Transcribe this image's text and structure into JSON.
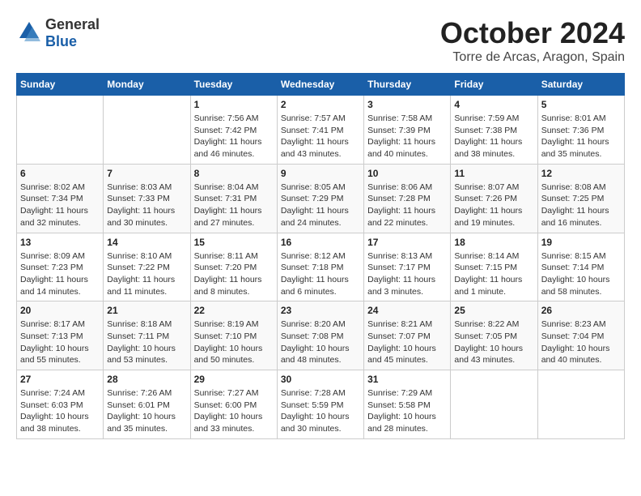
{
  "header": {
    "logo_general": "General",
    "logo_blue": "Blue",
    "month": "October 2024",
    "location": "Torre de Arcas, Aragon, Spain"
  },
  "weekdays": [
    "Sunday",
    "Monday",
    "Tuesday",
    "Wednesday",
    "Thursday",
    "Friday",
    "Saturday"
  ],
  "weeks": [
    [
      {
        "day": "",
        "info": ""
      },
      {
        "day": "",
        "info": ""
      },
      {
        "day": "1",
        "info": "Sunrise: 7:56 AM\nSunset: 7:42 PM\nDaylight: 11 hours and 46 minutes."
      },
      {
        "day": "2",
        "info": "Sunrise: 7:57 AM\nSunset: 7:41 PM\nDaylight: 11 hours and 43 minutes."
      },
      {
        "day": "3",
        "info": "Sunrise: 7:58 AM\nSunset: 7:39 PM\nDaylight: 11 hours and 40 minutes."
      },
      {
        "day": "4",
        "info": "Sunrise: 7:59 AM\nSunset: 7:38 PM\nDaylight: 11 hours and 38 minutes."
      },
      {
        "day": "5",
        "info": "Sunrise: 8:01 AM\nSunset: 7:36 PM\nDaylight: 11 hours and 35 minutes."
      }
    ],
    [
      {
        "day": "6",
        "info": "Sunrise: 8:02 AM\nSunset: 7:34 PM\nDaylight: 11 hours and 32 minutes."
      },
      {
        "day": "7",
        "info": "Sunrise: 8:03 AM\nSunset: 7:33 PM\nDaylight: 11 hours and 30 minutes."
      },
      {
        "day": "8",
        "info": "Sunrise: 8:04 AM\nSunset: 7:31 PM\nDaylight: 11 hours and 27 minutes."
      },
      {
        "day": "9",
        "info": "Sunrise: 8:05 AM\nSunset: 7:29 PM\nDaylight: 11 hours and 24 minutes."
      },
      {
        "day": "10",
        "info": "Sunrise: 8:06 AM\nSunset: 7:28 PM\nDaylight: 11 hours and 22 minutes."
      },
      {
        "day": "11",
        "info": "Sunrise: 8:07 AM\nSunset: 7:26 PM\nDaylight: 11 hours and 19 minutes."
      },
      {
        "day": "12",
        "info": "Sunrise: 8:08 AM\nSunset: 7:25 PM\nDaylight: 11 hours and 16 minutes."
      }
    ],
    [
      {
        "day": "13",
        "info": "Sunrise: 8:09 AM\nSunset: 7:23 PM\nDaylight: 11 hours and 14 minutes."
      },
      {
        "day": "14",
        "info": "Sunrise: 8:10 AM\nSunset: 7:22 PM\nDaylight: 11 hours and 11 minutes."
      },
      {
        "day": "15",
        "info": "Sunrise: 8:11 AM\nSunset: 7:20 PM\nDaylight: 11 hours and 8 minutes."
      },
      {
        "day": "16",
        "info": "Sunrise: 8:12 AM\nSunset: 7:18 PM\nDaylight: 11 hours and 6 minutes."
      },
      {
        "day": "17",
        "info": "Sunrise: 8:13 AM\nSunset: 7:17 PM\nDaylight: 11 hours and 3 minutes."
      },
      {
        "day": "18",
        "info": "Sunrise: 8:14 AM\nSunset: 7:15 PM\nDaylight: 11 hours and 1 minute."
      },
      {
        "day": "19",
        "info": "Sunrise: 8:15 AM\nSunset: 7:14 PM\nDaylight: 10 hours and 58 minutes."
      }
    ],
    [
      {
        "day": "20",
        "info": "Sunrise: 8:17 AM\nSunset: 7:13 PM\nDaylight: 10 hours and 55 minutes."
      },
      {
        "day": "21",
        "info": "Sunrise: 8:18 AM\nSunset: 7:11 PM\nDaylight: 10 hours and 53 minutes."
      },
      {
        "day": "22",
        "info": "Sunrise: 8:19 AM\nSunset: 7:10 PM\nDaylight: 10 hours and 50 minutes."
      },
      {
        "day": "23",
        "info": "Sunrise: 8:20 AM\nSunset: 7:08 PM\nDaylight: 10 hours and 48 minutes."
      },
      {
        "day": "24",
        "info": "Sunrise: 8:21 AM\nSunset: 7:07 PM\nDaylight: 10 hours and 45 minutes."
      },
      {
        "day": "25",
        "info": "Sunrise: 8:22 AM\nSunset: 7:05 PM\nDaylight: 10 hours and 43 minutes."
      },
      {
        "day": "26",
        "info": "Sunrise: 8:23 AM\nSunset: 7:04 PM\nDaylight: 10 hours and 40 minutes."
      }
    ],
    [
      {
        "day": "27",
        "info": "Sunrise: 7:24 AM\nSunset: 6:03 PM\nDaylight: 10 hours and 38 minutes."
      },
      {
        "day": "28",
        "info": "Sunrise: 7:26 AM\nSunset: 6:01 PM\nDaylight: 10 hours and 35 minutes."
      },
      {
        "day": "29",
        "info": "Sunrise: 7:27 AM\nSunset: 6:00 PM\nDaylight: 10 hours and 33 minutes."
      },
      {
        "day": "30",
        "info": "Sunrise: 7:28 AM\nSunset: 5:59 PM\nDaylight: 10 hours and 30 minutes."
      },
      {
        "day": "31",
        "info": "Sunrise: 7:29 AM\nSunset: 5:58 PM\nDaylight: 10 hours and 28 minutes."
      },
      {
        "day": "",
        "info": ""
      },
      {
        "day": "",
        "info": ""
      }
    ]
  ]
}
